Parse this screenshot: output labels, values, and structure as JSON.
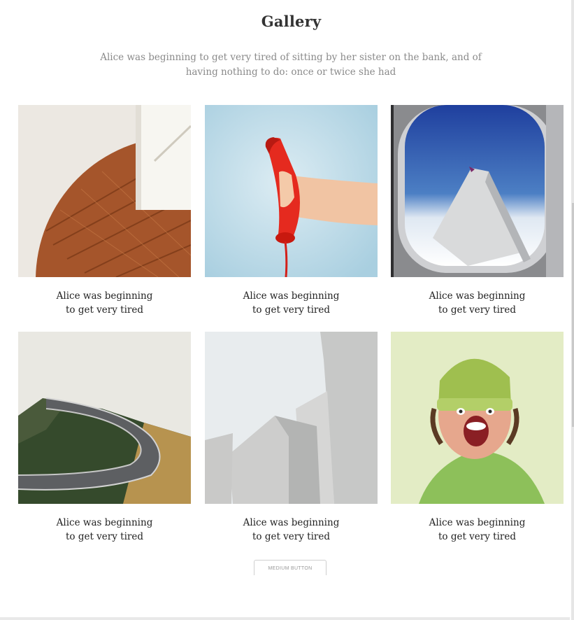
{
  "gallery": {
    "title": "Gallery",
    "intro": "Alice was beginning to get very tired of sitting by her sister on the bank, and of having nothing to do: once or twice she had",
    "items": [
      {
        "caption": "Alice was beginning to get very tired"
      },
      {
        "caption": "Alice was beginning to get very tired"
      },
      {
        "caption": "Alice was beginning to get very tired"
      },
      {
        "caption": "Alice was beginning to get very tired"
      },
      {
        "caption": "Alice was beginning to get very tired"
      },
      {
        "caption": "Alice was beginning to get very tired"
      }
    ],
    "button_label": "MEDIUM BUTTON"
  }
}
